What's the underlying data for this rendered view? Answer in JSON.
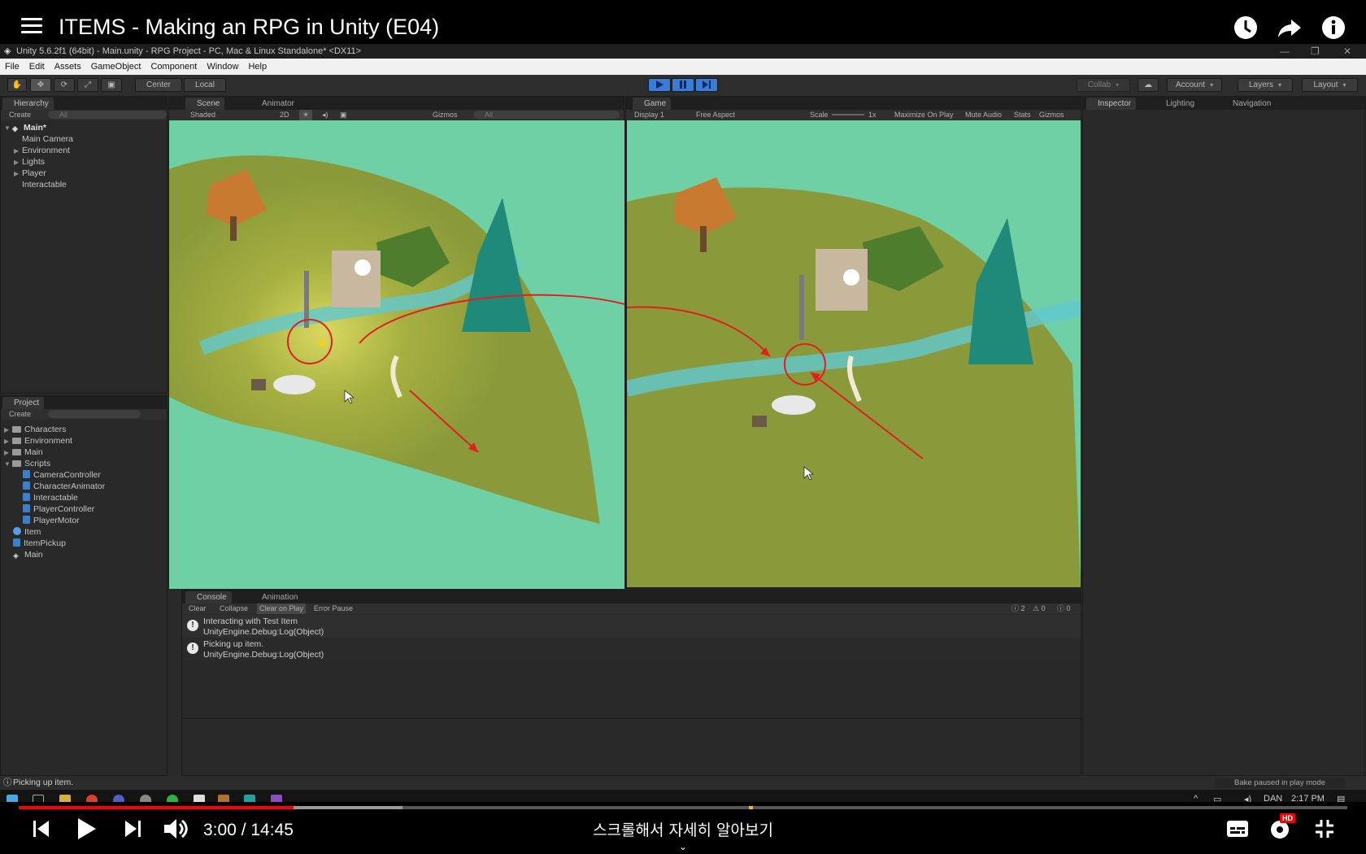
{
  "youtube": {
    "title": "ITEMS - Making an RPG in Unity (E04)",
    "time": "3:00 / 14:45",
    "scroll_hint": "스크롤해서 자세히 알아보기",
    "hd_badge": "HD",
    "progress_played_pct": 20.7,
    "progress_buffered_pct": 28.9
  },
  "unity": {
    "window_title": "Unity 5.6.2f1 (64bit) - Main.unity - RPG Project - PC, Mac & Linux Standalone* <DX11>",
    "menu": [
      "File",
      "Edit",
      "Assets",
      "GameObject",
      "Component",
      "Window",
      "Help"
    ],
    "toolbar": {
      "pivot": "Center",
      "space": "Local",
      "collab": "Collab",
      "account": "Account",
      "layers": "Layers",
      "layout": "Layout"
    },
    "hierarchy": {
      "tab": "Hierarchy",
      "create": "Create",
      "search": "All",
      "scene": "Main*",
      "items": [
        {
          "label": "Main Camera",
          "arrow": ""
        },
        {
          "label": "Environment",
          "arrow": "▶"
        },
        {
          "label": "Lights",
          "arrow": "▶"
        },
        {
          "label": "Player",
          "arrow": "▶"
        },
        {
          "label": "Interactable",
          "arrow": ""
        }
      ]
    },
    "scene_view": {
      "tabs": [
        "Scene",
        "Animator"
      ],
      "shading": "Shaded",
      "mode2d": "2D",
      "gizmos": "Gizmos",
      "search": "All"
    },
    "game_view": {
      "tab": "Game",
      "display": "Display 1",
      "aspect": "Free Aspect",
      "scale_label": "Scale",
      "scale_value": "1x",
      "options": [
        "Maximize On Play",
        "Mute Audio",
        "Stats",
        "Gizmos"
      ]
    },
    "inspector_tabs": [
      "Inspector",
      "Lighting",
      "Navigation"
    ],
    "project": {
      "tab": "Project",
      "create": "Create",
      "folders": [
        {
          "label": "Characters",
          "arrow": "▶"
        },
        {
          "label": "Environment",
          "arrow": "▶"
        },
        {
          "label": "Main",
          "arrow": "▶"
        },
        {
          "label": "Scripts",
          "arrow": "▼"
        }
      ],
      "scripts": [
        "CameraController",
        "CharacterAnimator",
        "Interactable",
        "PlayerController",
        "PlayerMotor"
      ],
      "assets": [
        {
          "label": "Item",
          "icon": "scriptable-object-icon"
        },
        {
          "label": "ItemPickup",
          "icon": "script-icon"
        },
        {
          "label": "Main",
          "icon": "unity-scene-icon"
        }
      ]
    },
    "console": {
      "tabs": [
        "Console",
        "Animation"
      ],
      "buttons": [
        "Clear",
        "Collapse",
        "Clear on Play",
        "Error Pause"
      ],
      "counts": {
        "logs": "2",
        "warnings": "0",
        "errors": "0"
      },
      "entries": [
        {
          "line1": "Interacting with Test Item",
          "line2": "UnityEngine.Debug:Log(Object)"
        },
        {
          "line1": "Picking up item.",
          "line2": "UnityEngine.Debug:Log(Object)"
        }
      ]
    },
    "status_text": "Picking up item.",
    "bake_status": "Bake paused in play mode"
  },
  "taskbar": {
    "user": "DAN",
    "clock": "2:17 PM"
  },
  "colors": {
    "youtube_red": "#ff0000",
    "play_button": "#3a7bd5",
    "terrain_green": "#8a9a3a",
    "water": "#6fd0a6",
    "annotation_red": "#e02020"
  }
}
